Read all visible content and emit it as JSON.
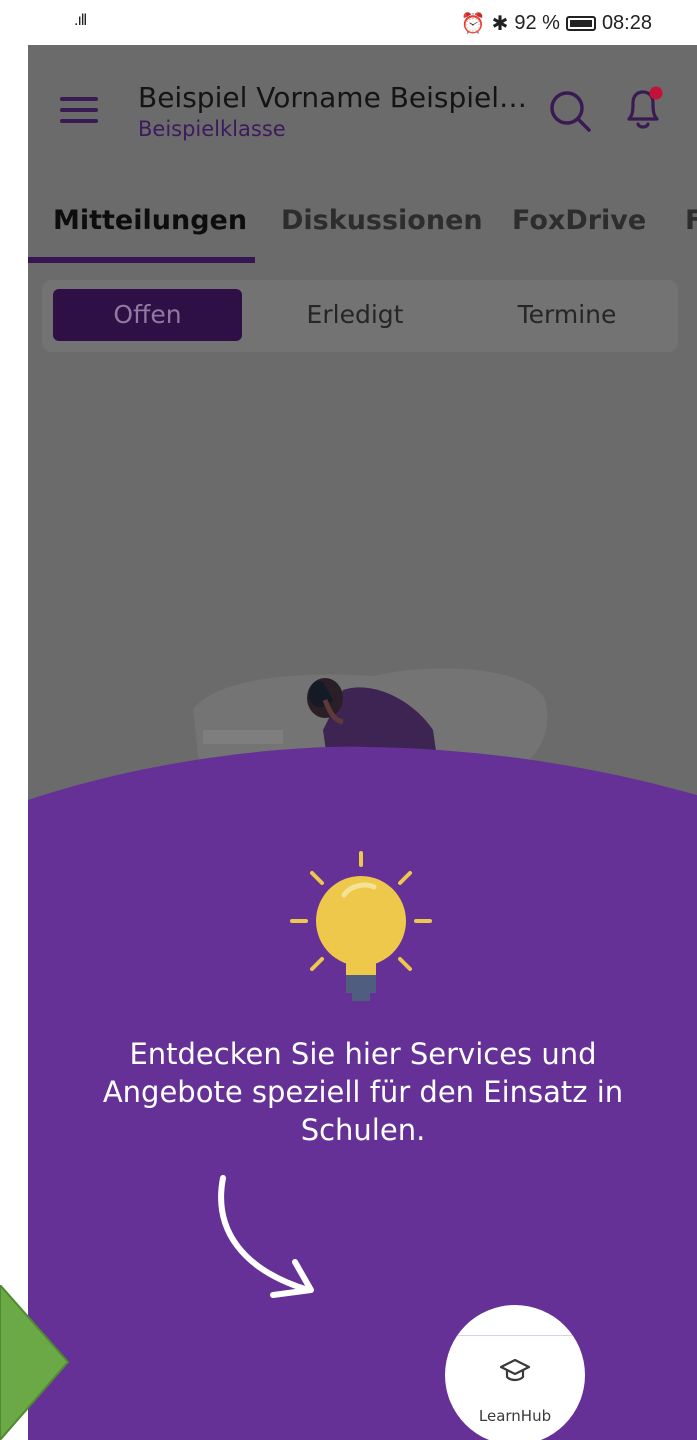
{
  "status_bar": {
    "signal": ".ıll",
    "battery_text": "92 %",
    "time": "08:28"
  },
  "app_bar": {
    "title": "Beispiel Vorname Beispiel…",
    "subtitle": "Beispielklasse",
    "menu_icon": "hamburger-menu-icon",
    "search_icon": "search-icon",
    "notification_icon": "bell-icon",
    "notification_badge_color": "#c2123a"
  },
  "tabs": [
    {
      "label": "Mitteilungen",
      "active": true
    },
    {
      "label": "Diskussionen",
      "active": false
    },
    {
      "label": "FoxDrive",
      "active": false
    },
    {
      "label": "F",
      "active": false
    }
  ],
  "filter": [
    {
      "label": "Offen",
      "active": true
    },
    {
      "label": "Erledigt",
      "active": false
    },
    {
      "label": "Termine",
      "active": false
    }
  ],
  "onboarding": {
    "text": "Entdecken Sie hier Services und Angebote speziell für den Einsatz in Schulen.",
    "icon": "lightbulb-icon",
    "arrow_icon": "curved-arrow-icon",
    "target": {
      "label": "LearnHub",
      "icon": "graduation-cap-icon"
    }
  },
  "colors": {
    "primary": "#3d1a5e",
    "overlay_purple": "#653196",
    "dim_background": "#6b6b6b",
    "bulb_yellow": "#edc84a",
    "tour_arrow_green": "#6ba846"
  }
}
